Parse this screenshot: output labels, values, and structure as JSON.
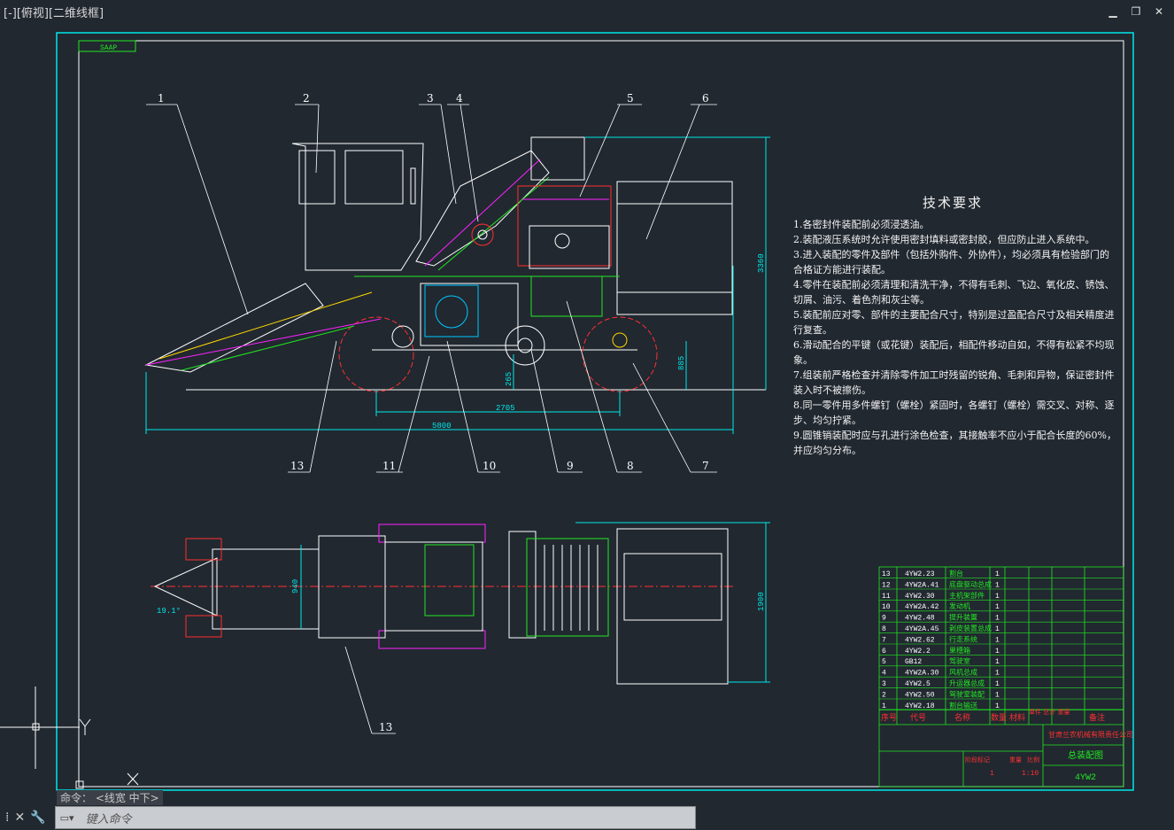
{
  "viewport": {
    "label": "[-][俯视][二维线框]"
  },
  "window_controls": {
    "minimize": "▁",
    "restore": "❐",
    "close": "✕"
  },
  "notes": {
    "title": "技术要求",
    "lines": [
      "1.各密封件装配前必须浸透油。",
      "2.装配液压系统时允许使用密封填料或密封胶，但应防止进入系统中。",
      "3.进入装配的零件及部件（包括外购件、外协件），均必须具有检验部门的",
      "合格证方能进行装配。",
      "4.零件在装配前必须清理和清洗干净，不得有毛刺、飞边、氧化皮、锈蚀、",
      "切屑、油污、着色剂和灰尘等。",
      "5.装配前应对零、部件的主要配合尺寸，特别是过盈配合尺寸及相关精度进",
      "行复查。",
      "6.滑动配合的平键（或花键）装配后，相配件移动自如，不得有松紧不均现",
      "象。",
      "7.组装前严格检查并清除零件加工时残留的锐角、毛刺和异物，保证密封件",
      "装入时不被擦伤。",
      "8.同一零件用多件螺钉（螺栓）紧固时，各螺钉（螺栓）需交叉、对称、逐",
      "步、均匀拧紧。",
      "9.圆锥销装配时应与孔进行涂色检查，其接触率不应小于配合长度的60%，",
      "并应均匀分布。"
    ]
  },
  "drawing": {
    "stamp": "SAAP",
    "balloons": [
      "1",
      "2",
      "3",
      "4",
      "5",
      "6",
      "7",
      "8",
      "9",
      "10",
      "11",
      "13",
      "13"
    ],
    "dims": {
      "length": "5800",
      "wheelbase": "2705",
      "height": "3360",
      "axle": "885",
      "ground": "265",
      "width": "1900",
      "track": "940",
      "angle": "19.1°"
    }
  },
  "bom": {
    "rows": [
      [
        "13",
        "4YW2.23",
        "割台",
        "1"
      ],
      [
        "12",
        "4YW2A.41",
        "底盘驱动总成",
        "1"
      ],
      [
        "11",
        "4YW2.30",
        "主机架部件",
        "1"
      ],
      [
        "10",
        "4YW2A.42",
        "发动机",
        "1"
      ],
      [
        "9",
        "4YW2.48",
        "提升装置",
        "1"
      ],
      [
        "8",
        "4YW2A.45",
        "剥皮装置总成",
        "1"
      ],
      [
        "7",
        "4YW2.62",
        "行走系统",
        "1"
      ],
      [
        "6",
        "4YW2.2",
        "果穗箱",
        "1"
      ],
      [
        "5",
        "GB12",
        "驾驶室",
        "1"
      ],
      [
        "4",
        "4YW2A.30",
        "风机总成",
        "1"
      ],
      [
        "3",
        "4YW2.5",
        "升运器总成",
        "1"
      ],
      [
        "2",
        "4YW2.50",
        "驾驶室装配",
        "1"
      ],
      [
        "1",
        "4YW2.18",
        "割台输送",
        "1"
      ]
    ],
    "header": [
      "序号",
      "代号",
      "名称",
      "数量",
      "材料",
      "单件 总计 重量",
      "备注"
    ],
    "company": "甘肃兰农机械有限责任公司",
    "drawing_title": "总装配图",
    "drawing_no": "4YW2",
    "scale": "1:10",
    "qty": "1",
    "labels": {
      "weight": "重量",
      "scale_label": "比例",
      "stage": "阶段标记"
    }
  },
  "command": {
    "history": "命令：  <线宽 中下>",
    "placeholder": "键入命令"
  },
  "colors": {
    "background": "#212830",
    "frame": "#00e0ff",
    "line": "#ffffff",
    "accent_green": "#22e822",
    "accent_magenta": "#ff22ff"
  }
}
